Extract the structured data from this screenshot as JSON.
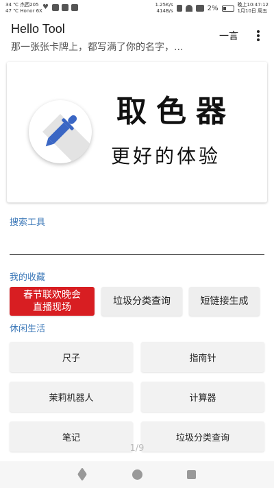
{
  "status_bar": {
    "left_line1": "34 ℃ 杰西205",
    "left_line2": "47 ℃ Honor 6X",
    "speed_line1": "1.25K/s",
    "speed_line2": "414B/s",
    "battery_pct": "2%",
    "time_line1": "晚上10:47:12",
    "time_line2": "1月10日 周五"
  },
  "app_bar": {
    "title": "Hello Tool",
    "subtitle": "那一张张卡牌上，都写满了你的名字，...",
    "action_label": "一言"
  },
  "banner": {
    "title": "取色器",
    "slogan": "更好的体验"
  },
  "search": {
    "section_title": "搜索工具",
    "value": ""
  },
  "favorites": {
    "section_title": "我的收藏",
    "items": [
      {
        "label_line1": "春节联欢晚会",
        "label_line2": "直播现场"
      },
      {
        "label": "垃圾分类查询"
      },
      {
        "label": "短链接生成"
      }
    ]
  },
  "leisure": {
    "section_title": "休闲生活",
    "items": [
      {
        "label": "尺子"
      },
      {
        "label": "指南针"
      },
      {
        "label": "茉莉机器人"
      },
      {
        "label": "计算器"
      },
      {
        "label": "笔记"
      },
      {
        "label": "垃圾分类查询"
      }
    ]
  },
  "page_indicator": "1/9",
  "colors": {
    "accent": "#3c78b8",
    "highlight_button": "#d81e22",
    "dropper_blue": "#3a66c4"
  }
}
